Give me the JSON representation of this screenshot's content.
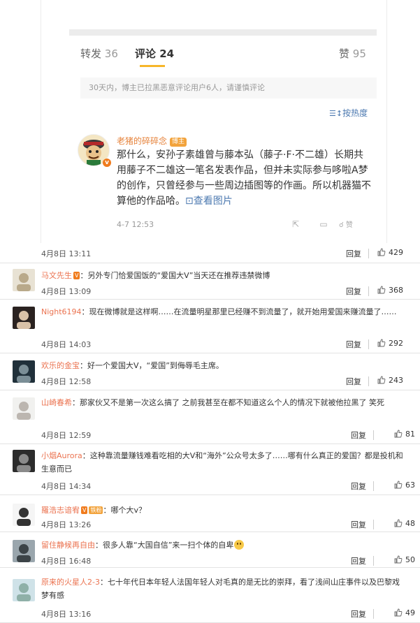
{
  "tabs": [
    {
      "label": "转发",
      "count": "36"
    },
    {
      "label": "评论",
      "count": "24"
    },
    {
      "label": "赞",
      "count": "95"
    }
  ],
  "notice": "30天内，博主已拉黑恶意评论用户6人，请谨慎评论",
  "sort_label": "按热度",
  "top_comment": {
    "author": "老猪的碎碎念",
    "badge": "博主",
    "text": "那什么，安孙子素雄曾与藤本弘（藤子·F·不二雄）长期共用藤子不二雄这一笔名发表作品，但并未实际参与哆啦A梦的创作，只曾经参与一些周边插图等的作画。所以机器猫不算他的作品哈。",
    "link": "查看图片",
    "time": "4-7 12:53",
    "actions": [
      "转发",
      "评论",
      "点赞"
    ]
  },
  "reply_label": "回复",
  "comments": [
    {
      "name": "",
      "text": "",
      "date": "4月8日 13:11",
      "likes": "429"
    },
    {
      "name": "马文先生",
      "badge": "V",
      "text": "另外专门恰爱国饭的“爱国大V”当天还在推荐违禁微博",
      "date": "4月8日 13:09",
      "likes": "368"
    },
    {
      "name": "Night6194",
      "text": "现在微博就是这样啊……在流量明星那里已经赚不到流量了，就开始用爱国来赚流量了……",
      "date": "4月8日 14:03",
      "likes": "292"
    },
    {
      "name": "欢乐的金宝",
      "text": "好一个爱国大V，“爱国”到侮辱毛主席。",
      "date": "4月8日 12:58",
      "likes": "243"
    },
    {
      "name": "山崎春希",
      "text": "那家伙又不是第一次这么搞了 之前我甚至在都不知道这么个人的情况下就被他拉黑了 笑死",
      "date": "4月8日 12:59",
      "likes": "81"
    },
    {
      "name": "小烟Aurora",
      "text": "这种靠流量赚钱难看吃相的大V和“海外”公众号太多了……哪有什么真正的爱国？都是投机和生意而已",
      "date": "4月8日 14:34",
      "likes": "63"
    },
    {
      "name": "羅浩志谙宥",
      "badge": "V",
      "fan_badge": "铁粉",
      "text": "哪个大v？",
      "date": "4月8日 13:26",
      "likes": "48"
    },
    {
      "name": "留住静候再自由",
      "text": "很多人靠“大国自信”来一扫个体的自卑",
      "date": "4月8日 16:48",
      "likes": "50"
    },
    {
      "name": "原来的火星人2-3",
      "text": "七十年代日本年轻人法国年轻人对毛真的是无比的崇拜，看了浅间山庄事件以及巴黎戏梦有感",
      "date": "4月8日 13:16",
      "likes": "49"
    }
  ]
}
